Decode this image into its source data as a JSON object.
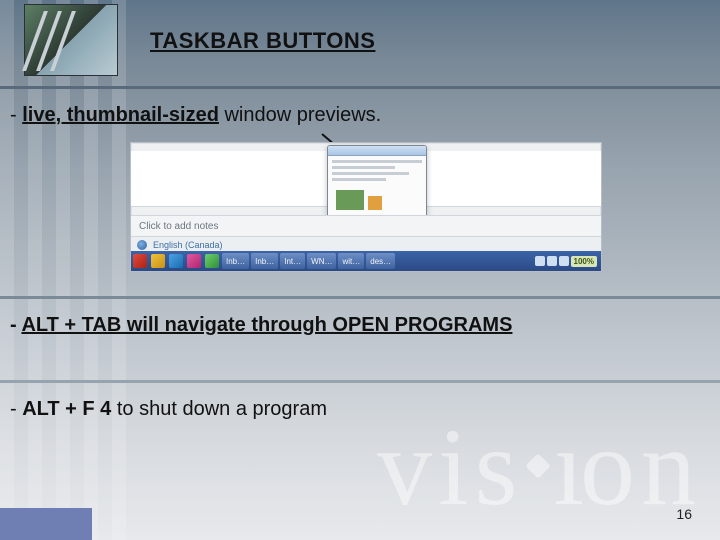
{
  "title": "TASKBAR BUTTONS",
  "bullets": {
    "b1_prefix": "- ",
    "b1_bold": "live, thumbnail-sized",
    "b1_rest": " window previews.",
    "b2_prefix": "- ",
    "b2_text": "ALT + TAB will navigate through OPEN PROGRAMS",
    "b3_prefix": "- ",
    "b3_bold": "ALT + F 4",
    "b3_rest": " to shut down a program"
  },
  "screenshot": {
    "notes_placeholder": "Click to add notes",
    "language": "English (Canada)",
    "taskbar_items": [
      "Inb…",
      "Inb…",
      "Int…",
      "WN…",
      "wit…",
      "des…"
    ],
    "tray_percent": "100%"
  },
  "watermark": "vision",
  "page_number": "16"
}
